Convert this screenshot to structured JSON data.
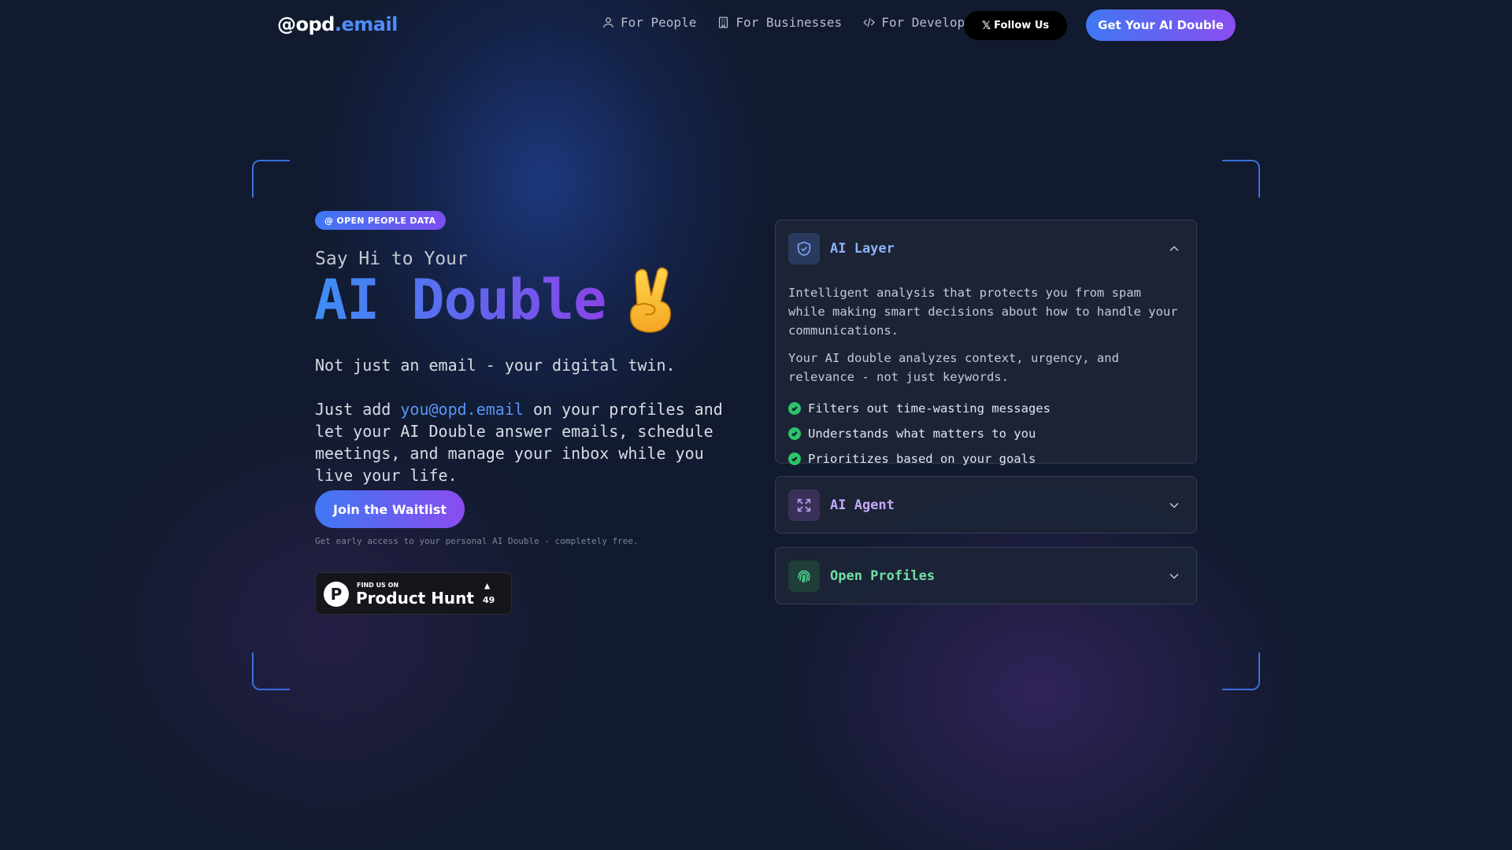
{
  "nav": {
    "logo_part1": "@opd",
    "logo_part2": ".email",
    "links": [
      {
        "label": "For People",
        "icon": "user-icon"
      },
      {
        "label": "For Businesses",
        "icon": "building-icon"
      },
      {
        "label": "For Developers",
        "icon": "code-icon"
      }
    ],
    "follow_label": "Follow Us",
    "follow_icon": "x-logo-icon",
    "cta_label": "Get Your AI Double"
  },
  "hero": {
    "badge": "@ OPEN PEOPLE DATA",
    "say_hi": "Say Hi to Your",
    "headline": "AI Double",
    "headline_emoji": "victory-hand-emoji",
    "tagline": "Not just an email - your digital twin.",
    "desc_prefix": "Just add ",
    "desc_link": "you@opd.email",
    "desc_suffix": " on your profiles and let your AI Double answer emails, schedule meetings, and manage your inbox while you live your life.",
    "waitlist_label": "Join the Waitlist",
    "early_access": "Get early access to your personal AI Double - completely free.",
    "product_hunt": {
      "small": "FIND US ON",
      "big": "Product Hunt",
      "upvote_icon": "triangle-up-icon",
      "count": "49"
    }
  },
  "features": [
    {
      "title": "AI Layer",
      "icon": "shield-check-icon",
      "expanded": true,
      "paragraphs": [
        "Intelligent analysis that protects you from spam while making smart decisions about how to handle your communications.",
        "Your AI double analyzes context, urgency, and relevance - not just keywords."
      ],
      "bullets": [
        "Filters out time-wasting messages",
        "Understands what matters to you",
        "Prioritizes based on your goals"
      ]
    },
    {
      "title": "AI Agent",
      "icon": "expand-arrows-icon",
      "expanded": false
    },
    {
      "title": "Open Profiles",
      "icon": "fingerprint-icon",
      "expanded": false
    }
  ],
  "colors": {
    "background": "#111a2e",
    "accent_blue": "#3f78f2",
    "accent_purple": "#8a4cf0",
    "link": "#5a94f5",
    "check_green": "#2cc46b"
  }
}
